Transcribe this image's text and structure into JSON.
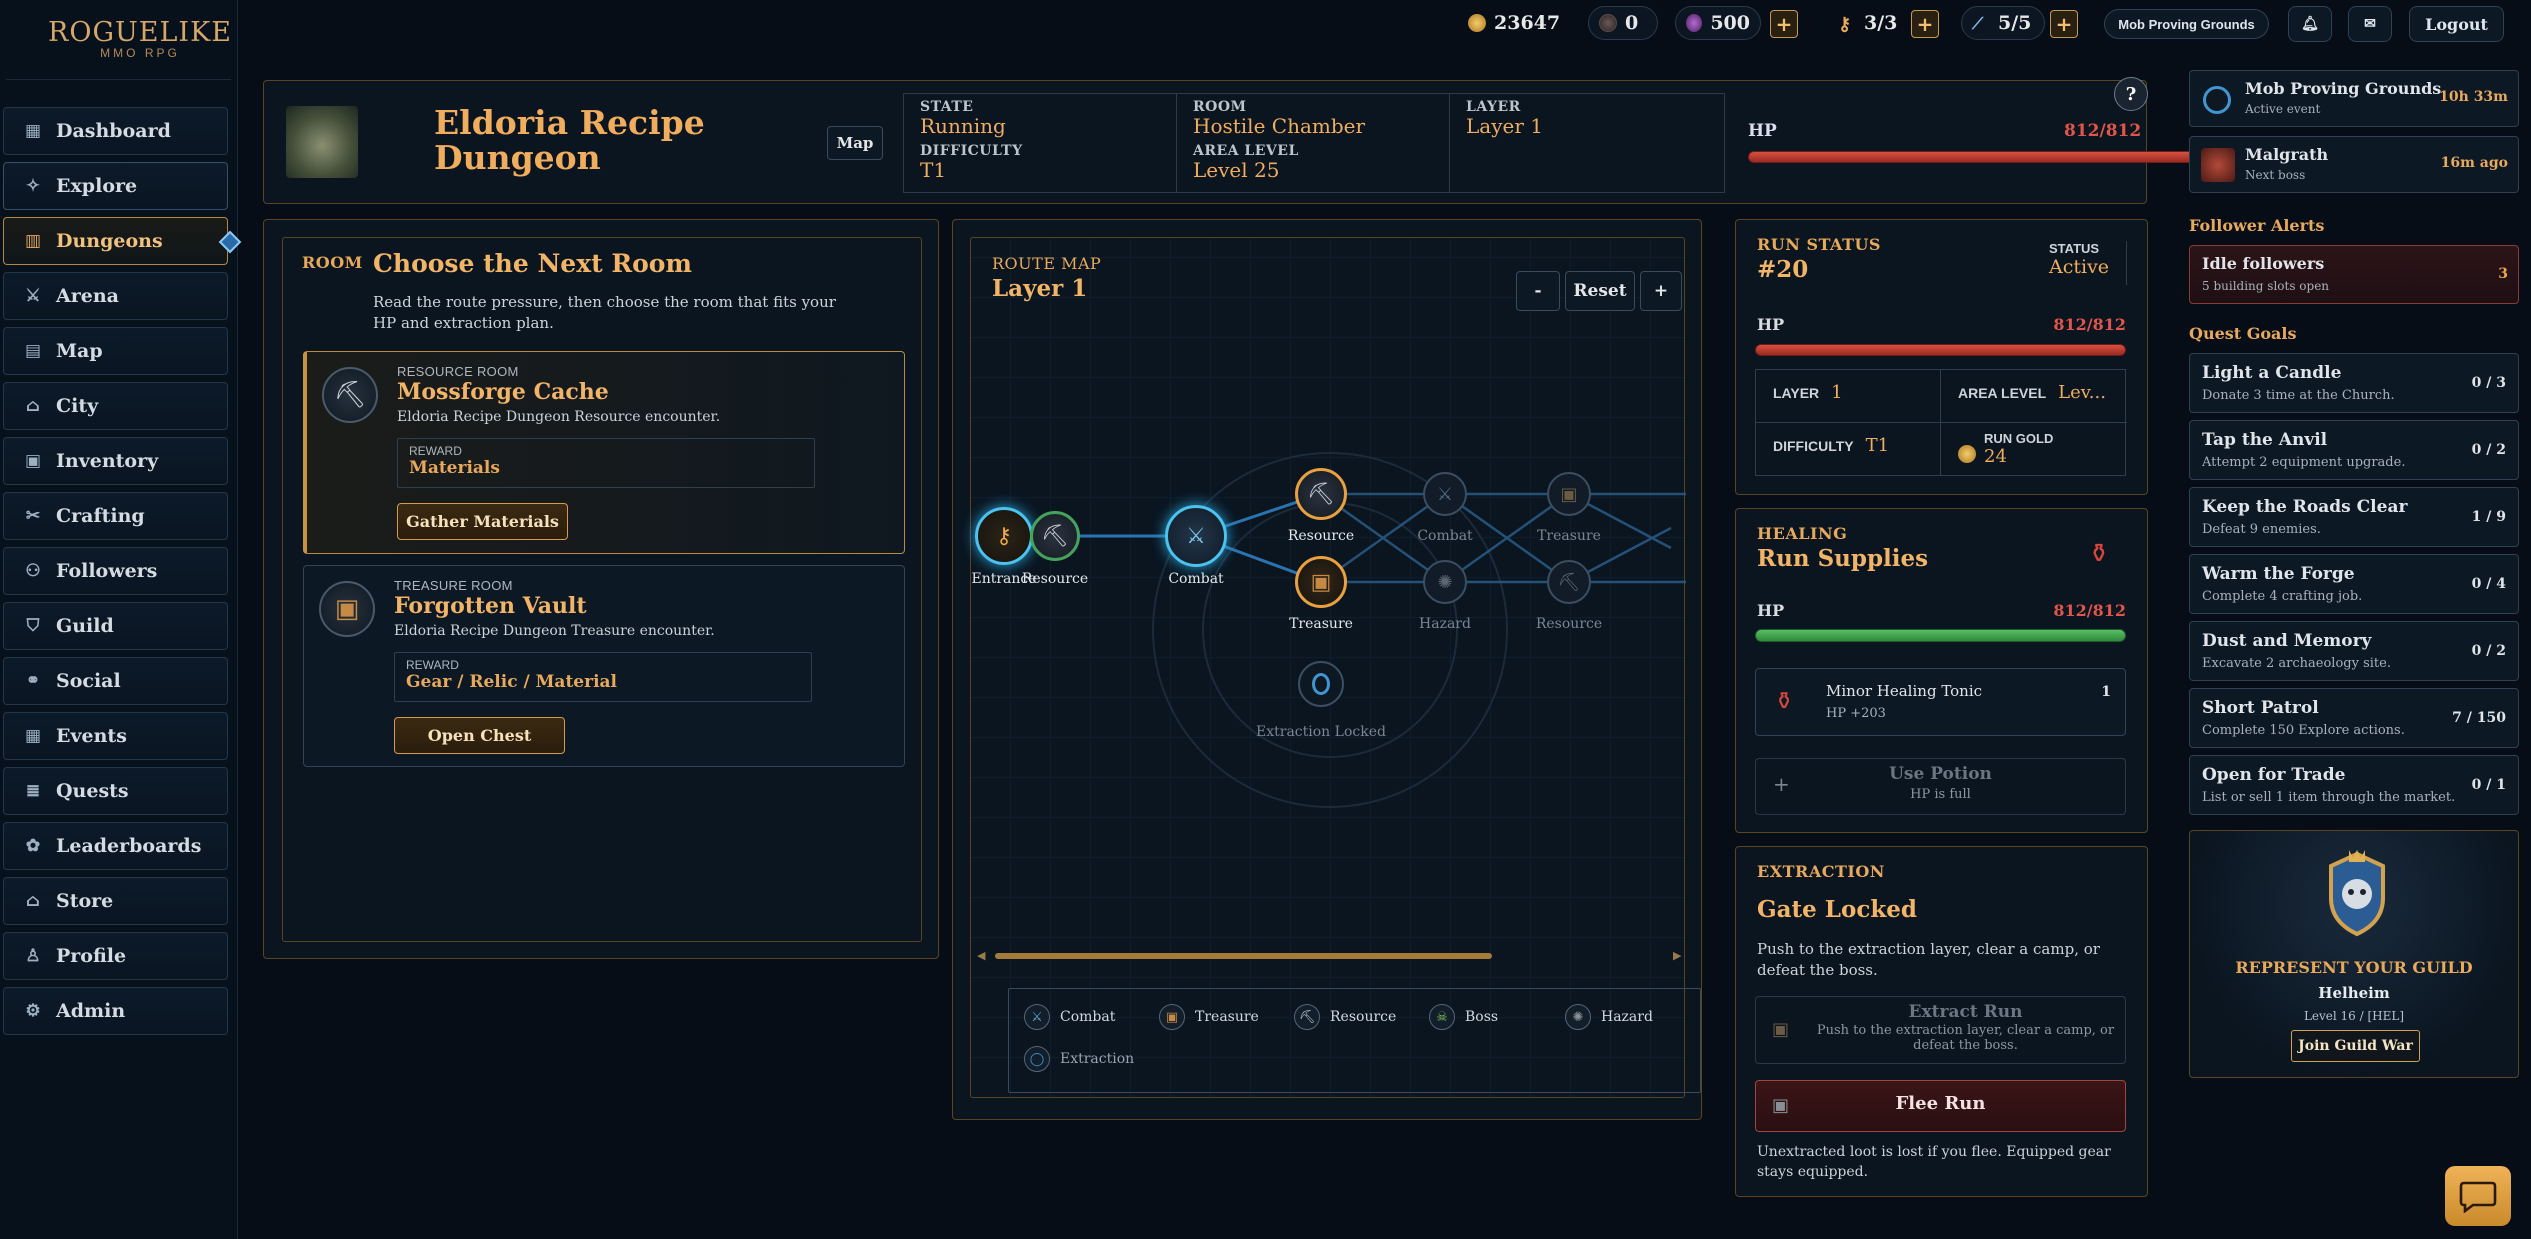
{
  "app": {
    "logo_title": "ROGUELIKE",
    "logo_sub": "MMO RPG"
  },
  "nav": [
    {
      "label": "Dashboard",
      "icon": "dashboard-icon"
    },
    {
      "label": "Explore",
      "icon": "compass-icon"
    },
    {
      "label": "Dungeons",
      "icon": "pillar-icon"
    },
    {
      "label": "Arena",
      "icon": "sword-icon"
    },
    {
      "label": "Map",
      "icon": "map-icon"
    },
    {
      "label": "City",
      "icon": "city-icon"
    },
    {
      "label": "Inventory",
      "icon": "inventory-icon"
    },
    {
      "label": "Crafting",
      "icon": "crafting-icon"
    },
    {
      "label": "Followers",
      "icon": "followers-icon"
    },
    {
      "label": "Guild",
      "icon": "shield-icon"
    },
    {
      "label": "Social",
      "icon": "social-icon"
    },
    {
      "label": "Events",
      "icon": "calendar-icon"
    },
    {
      "label": "Quests",
      "icon": "scroll-icon"
    },
    {
      "label": "Leaderboards",
      "icon": "laurel-icon"
    },
    {
      "label": "Store",
      "icon": "store-icon"
    },
    {
      "label": "Profile",
      "icon": "profile-icon"
    },
    {
      "label": "Admin",
      "icon": "admin-icon"
    }
  ],
  "topbar": {
    "gold": "23647",
    "orbs": "0",
    "gems": "500",
    "keys": "3/3",
    "energy": "5/5",
    "event_button": "Mob Proving Grounds",
    "logout": "Logout",
    "plus": "+"
  },
  "dungeon": {
    "title": "Eldoria Recipe Dungeon",
    "map_button": "Map",
    "state_label": "STATE",
    "state": "Running",
    "difficulty_label": "DIFFICULTY",
    "difficulty": "T1",
    "room_label": "ROOM",
    "room": "Hostile Chamber",
    "area_level_label": "AREA LEVEL",
    "area_level": "Level 25",
    "layer_label": "LAYER",
    "layer": "Layer 1",
    "hp_label": "HP",
    "hp": "812/812",
    "help": "?"
  },
  "room_choice": {
    "kicker": "ROOM",
    "title": "Choose the Next Room",
    "desc": "Read the route pressure, then choose the room that fits your HP and extraction plan.",
    "rooms": [
      {
        "type": "RESOURCE ROOM",
        "name": "Mossforge Cache",
        "desc": "Eldoria Recipe Dungeon Resource encounter.",
        "reward_label": "REWARD",
        "reward": "Materials",
        "button": "Gather Materials"
      },
      {
        "type": "TREASURE ROOM",
        "name": "Forgotten Vault",
        "desc": "Eldoria Recipe Dungeon Treasure encounter.",
        "reward_label": "REWARD",
        "reward": "Gear / Relic / Material",
        "button": "Open Chest"
      }
    ]
  },
  "route_map": {
    "kicker": "ROUTE MAP",
    "layer": "Layer 1",
    "zoom_out": "-",
    "reset": "Reset",
    "zoom_in": "+",
    "nodes": {
      "entrance": "Entrance",
      "resource1": "Resource",
      "combat1": "Combat",
      "resource2": "Resource",
      "treasure1": "Treasure",
      "combat2": "Combat",
      "hazard": "Hazard",
      "treasure2": "Treasure",
      "resource3": "Resource",
      "extraction": "Extraction Locked"
    },
    "legend": [
      "Combat",
      "Treasure",
      "Resource",
      "Boss",
      "Hazard",
      "Extraction"
    ],
    "scroll_position": 0.74
  },
  "run_status": {
    "kicker": "RUN STATUS",
    "run_id": "#20",
    "status_label": "STATUS",
    "status": "Active",
    "hp_label": "HP",
    "hp": "812/812",
    "layer_label": "LAYER",
    "layer": "1",
    "area_label": "AREA LEVEL",
    "area": "Lev...",
    "difficulty_label": "DIFFICULTY",
    "difficulty": "T1",
    "gold_label": "RUN GOLD",
    "gold": "24"
  },
  "healing": {
    "kicker": "HEALING",
    "title": "Run Supplies",
    "hp_label": "HP",
    "hp": "812/812",
    "item_name": "Minor Healing Tonic",
    "item_effect": "HP +203",
    "item_count": "1",
    "use_label": "Use Potion",
    "use_sub": "HP is full",
    "use_plus": "+"
  },
  "extraction": {
    "kicker": "EXTRACTION",
    "title": "Gate Locked",
    "desc": "Push to the extraction layer, clear a camp, or defeat the boss.",
    "extract_label": "Extract Run",
    "extract_sub": "Push to the extraction layer, clear a camp, or defeat the boss.",
    "flee_label": "Flee Run",
    "warning": "Unextracted loot is lost if you flee. Equipped gear stays equipped."
  },
  "right": {
    "events": [
      {
        "name": "Mob Proving Grounds",
        "sub": "Active event",
        "time": "10h 33m"
      },
      {
        "name": "Malgrath",
        "sub": "Next boss",
        "time": "16m ago"
      }
    ],
    "follower_alerts_head": "Follower Alerts",
    "idle": {
      "name": "Idle followers",
      "sub": "5 building slots open",
      "count": "3"
    },
    "quest_head": "Quest Goals",
    "quests": [
      {
        "name": "Light a Candle",
        "desc": "Donate 3 time at the Church.",
        "progress": "0 / 3"
      },
      {
        "name": "Tap the Anvil",
        "desc": "Attempt 2 equipment upgrade.",
        "progress": "0 / 2"
      },
      {
        "name": "Keep the Roads Clear",
        "desc": "Defeat 9 enemies.",
        "progress": "1 / 9"
      },
      {
        "name": "Warm the Forge",
        "desc": "Complete 4 crafting job.",
        "progress": "0 / 4"
      },
      {
        "name": "Dust and Memory",
        "desc": "Excavate 2 archaeology site.",
        "progress": "0 / 2"
      },
      {
        "name": "Short Patrol",
        "desc": "Complete 150 Explore actions.",
        "progress": "7 / 150"
      },
      {
        "name": "Open for Trade",
        "desc": "List or sell 1 item through the market.",
        "progress": "0 / 1"
      }
    ],
    "guild": {
      "headline": "REPRESENT YOUR GUILD",
      "name": "Helheim",
      "level": "Level 16 / [HEL]",
      "button": "Join Guild War"
    }
  },
  "colors": {
    "accent": "#e9a95a",
    "hp_red": "#d9503f",
    "hp_green": "#58c064",
    "bg": "#060d16"
  }
}
